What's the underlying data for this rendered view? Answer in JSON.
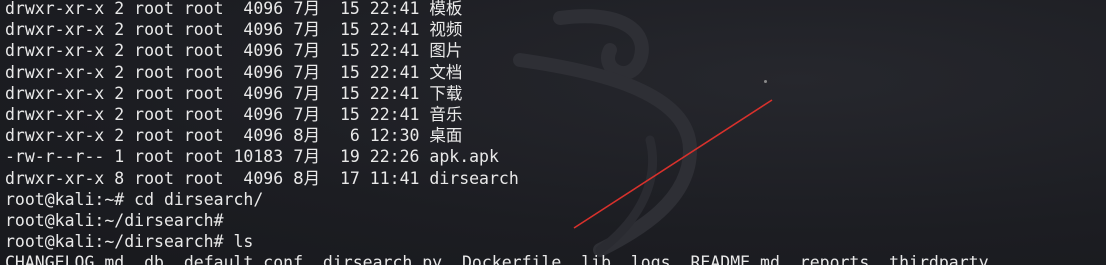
{
  "terminal": {
    "listing": [
      {
        "perms": "drwxr-xr-x",
        "links": "2",
        "owner": "root",
        "group": "root",
        "size": "4096",
        "month": "7月",
        "day": "15",
        "time": "22:41",
        "name": "模板"
      },
      {
        "perms": "drwxr-xr-x",
        "links": "2",
        "owner": "root",
        "group": "root",
        "size": "4096",
        "month": "7月",
        "day": "15",
        "time": "22:41",
        "name": "视频"
      },
      {
        "perms": "drwxr-xr-x",
        "links": "2",
        "owner": "root",
        "group": "root",
        "size": "4096",
        "month": "7月",
        "day": "15",
        "time": "22:41",
        "name": "图片"
      },
      {
        "perms": "drwxr-xr-x",
        "links": "2",
        "owner": "root",
        "group": "root",
        "size": "4096",
        "month": "7月",
        "day": "15",
        "time": "22:41",
        "name": "文档"
      },
      {
        "perms": "drwxr-xr-x",
        "links": "2",
        "owner": "root",
        "group": "root",
        "size": "4096",
        "month": "7月",
        "day": "15",
        "time": "22:41",
        "name": "下载"
      },
      {
        "perms": "drwxr-xr-x",
        "links": "2",
        "owner": "root",
        "group": "root",
        "size": "4096",
        "month": "7月",
        "day": "15",
        "time": "22:41",
        "name": "音乐"
      },
      {
        "perms": "drwxr-xr-x",
        "links": "2",
        "owner": "root",
        "group": "root",
        "size": "4096",
        "month": "8月",
        "day": "6",
        "time": "12:30",
        "name": "桌面"
      },
      {
        "perms": "-rw-r--r--",
        "links": "1",
        "owner": "root",
        "group": "root",
        "size": "10183",
        "month": "7月",
        "day": "19",
        "time": "22:26",
        "name": "apk.apk"
      },
      {
        "perms": "drwxr-xr-x",
        "links": "8",
        "owner": "root",
        "group": "root",
        "size": "4096",
        "month": "8月",
        "day": "17",
        "time": "11:41",
        "name": "dirsearch"
      }
    ],
    "commands": [
      {
        "prompt": "root@kali:~#",
        "command": "cd dirsearch/"
      },
      {
        "prompt": "root@kali:~/dirsearch#",
        "command": ""
      },
      {
        "prompt": "root@kali:~/dirsearch#",
        "command": "ls"
      }
    ],
    "ls_output": [
      "CHANGELOG.md",
      "db",
      "default.conf",
      "dirsearch.py",
      "Dockerfile",
      "lib",
      "logs",
      "README.md",
      "reports",
      "thirdparty"
    ]
  },
  "colors": {
    "background": "#1c1d22",
    "text": "#e9e9e9",
    "annotation_line": "#d8312c"
  }
}
